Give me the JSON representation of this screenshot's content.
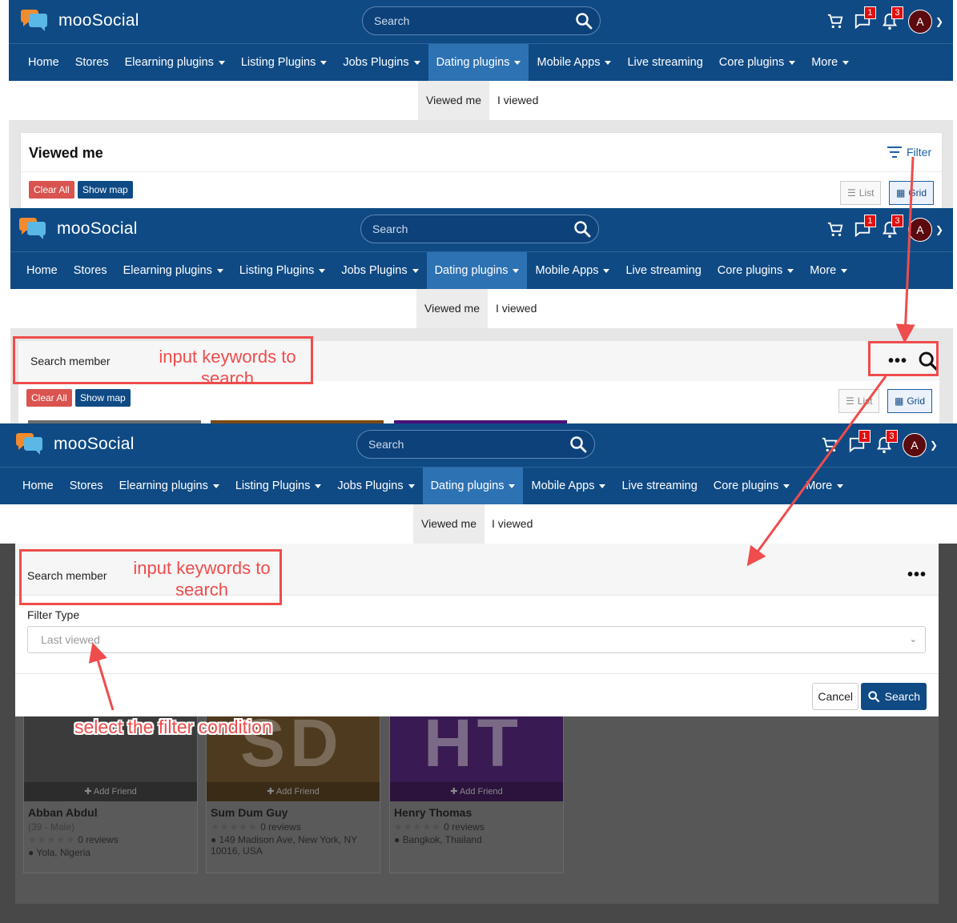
{
  "header": {
    "logo_text": "mooSocial",
    "search_placeholder": "Search",
    "messages_count": "1",
    "notifications_count": "3",
    "avatar_initial": "A"
  },
  "nav": {
    "items": [
      "Home",
      "Stores",
      "Elearning plugins",
      "Listing Plugins",
      "Jobs Plugins",
      "Dating plugins",
      "Mobile Apps",
      "Live streaming",
      "Core plugins",
      "More"
    ],
    "active": "Dating plugins"
  },
  "subtabs": {
    "viewed_me": "Viewed me",
    "i_viewed": "I viewed"
  },
  "page": {
    "title": "Viewed me",
    "filter": "Filter",
    "clear_all": "Clear All",
    "show_map": "Show map",
    "list": "List",
    "grid": "Grid"
  },
  "search_panel": {
    "placeholder": "Search member"
  },
  "modal": {
    "search_placeholder": "Search member",
    "filter_type_label": "Filter Type",
    "filter_type_value": "Last viewed",
    "cancel": "Cancel",
    "search": "Search"
  },
  "annotations": {
    "keywords_line1": "input keywords to",
    "keywords_line2": "search",
    "filter_hint": "select the filter condition",
    "accent": "#ef4c4c"
  },
  "members": [
    {
      "name": "Abban Abdul",
      "meta": "(39 - Male)",
      "reviews": "0 reviews",
      "location": "Yola, Nigeria",
      "add_friend": "Add Friend"
    },
    {
      "name": "Sum Dum Guy",
      "meta": "",
      "reviews": "0 reviews",
      "location": "149 Madison Ave, New York, NY 10016, USA",
      "add_friend": "Add Friend",
      "initials": "SD"
    },
    {
      "name": "Henry Thomas",
      "meta": "",
      "reviews": "0 reviews",
      "location": "Bangkok, Thailand",
      "add_friend": "Add Friend",
      "initials": "HT"
    }
  ],
  "colors": {
    "brand": "#0f4a84",
    "active_nav": "#2d72b3",
    "danger": "#d9534f",
    "badge": "#e20d0d"
  }
}
